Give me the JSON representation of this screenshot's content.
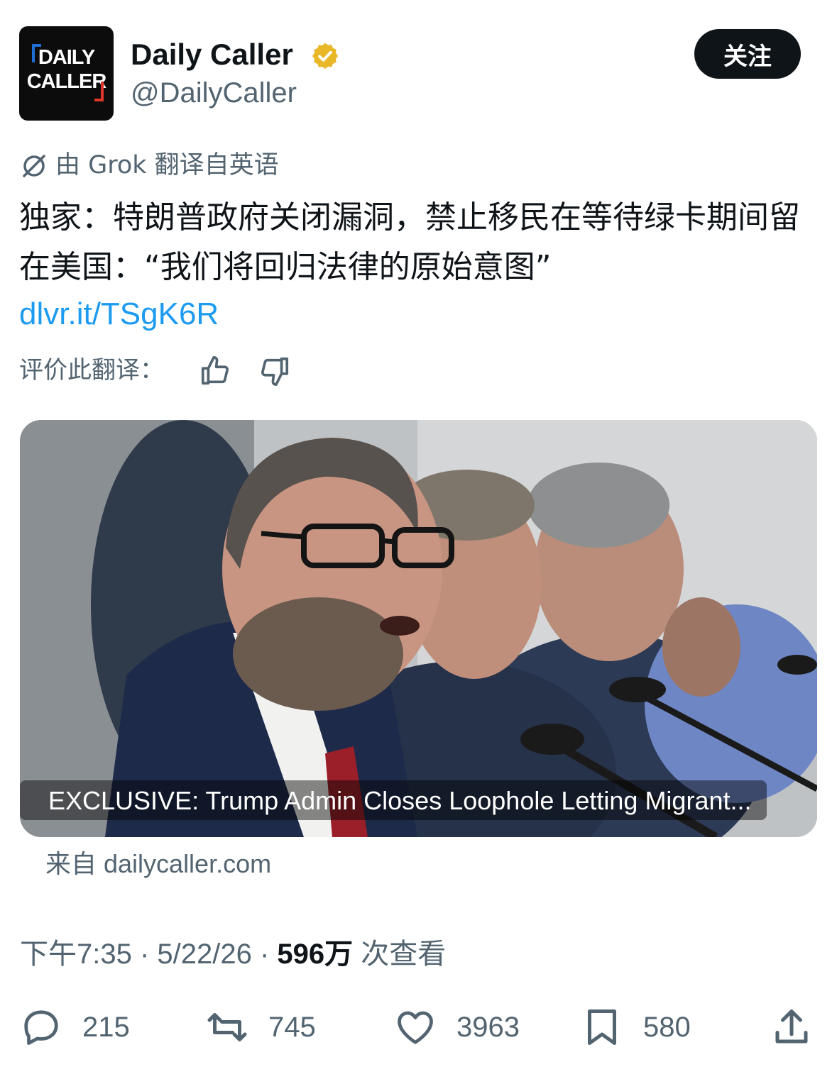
{
  "account": {
    "logo_line1": "DAILY",
    "logo_line2": "CALLER",
    "name": "Daily Caller",
    "handle": "@DailyCaller",
    "verified_icon": "verified-badge-icon"
  },
  "follow_label": "关注",
  "translation": {
    "note": "由 Grok 翻译自英语",
    "rate_label": "评价此翻译："
  },
  "tweet": {
    "text": "独家：特朗普政府关闭漏洞，禁止移民在等待绿卡期间留在美国：“我们将回归法律的原始意图”",
    "link": "dlvr.it/TSgK6R"
  },
  "card": {
    "caption": "EXCLUSIVE: Trump Admin Closes Loophole Letting Migrant...",
    "source": "来自 dailycaller.com"
  },
  "meta": {
    "time": "下午7:35",
    "date": "5/22/26",
    "views": "596万",
    "views_label": "次查看"
  },
  "actions": {
    "replies": "215",
    "reposts": "745",
    "likes": "3963",
    "bookmarks": "580"
  },
  "colors": {
    "link": "#1d9bf0",
    "muted": "#536471",
    "verified": "#e8b829",
    "button": "#0f1419"
  }
}
